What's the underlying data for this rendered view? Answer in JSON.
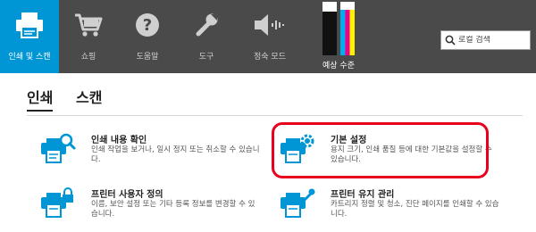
{
  "toolbar": {
    "items": [
      {
        "label": "인쇄 및 스캔",
        "icon": "printer-icon",
        "active": true
      },
      {
        "label": "쇼핑",
        "icon": "cart-icon"
      },
      {
        "label": "도움말",
        "icon": "help-icon"
      },
      {
        "label": "도구",
        "icon": "wrench-icon"
      },
      {
        "label": "정숙 모드",
        "icon": "quiet-mode-icon"
      }
    ],
    "ink": {
      "label": "예상 수준",
      "cartridges": [
        {
          "name": "black",
          "level": 0.82
        },
        {
          "name": "color",
          "level": 0.85
        }
      ],
      "colors": {
        "black": "#111111",
        "cyan": "#00aeef",
        "magenta": "#ec008c",
        "yellow": "#fff200"
      }
    },
    "search": {
      "placeholder": "로컬 검색",
      "value": ""
    }
  },
  "tabs": [
    {
      "label": "인쇄",
      "active": true
    },
    {
      "label": "스캔",
      "active": false
    }
  ],
  "cards": [
    {
      "title": "인쇄 내용 확인",
      "desc": "인쇄 작업을 보거나, 일시 정지 또는 취소할 수 있습니다.",
      "icon": "printer-search-icon"
    },
    {
      "title": "기본 설정",
      "desc": "용지 크기, 인쇄 품질 등에 대한 기본값을 설정할 수 있습니다.",
      "icon": "printer-settings-icon",
      "highlighted": true
    },
    {
      "title": "프린터 사용자 정의",
      "desc": "이름, 보안 설정 또는 기타 등록 정보를 변경할 수 있습니다.",
      "icon": "printer-lock-icon"
    },
    {
      "title": "프린터 유지 관리",
      "desc": "카트리지 정렬 및 청소, 진단 페이지를 인쇄할 수 있습니다.",
      "icon": "printer-maintenance-icon"
    }
  ],
  "colors": {
    "accent": "#0096d6",
    "toolbar": "#4a4a4a",
    "highlight": "#e8001c"
  }
}
